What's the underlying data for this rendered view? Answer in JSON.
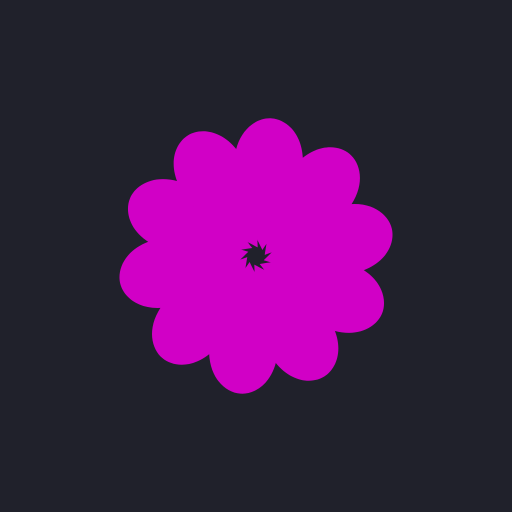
{
  "app": {
    "background_color": "#20212b"
  },
  "logo": {
    "icon": "flower-logo-icon",
    "petal_color": "#d100c6",
    "petal_count": 10
  }
}
